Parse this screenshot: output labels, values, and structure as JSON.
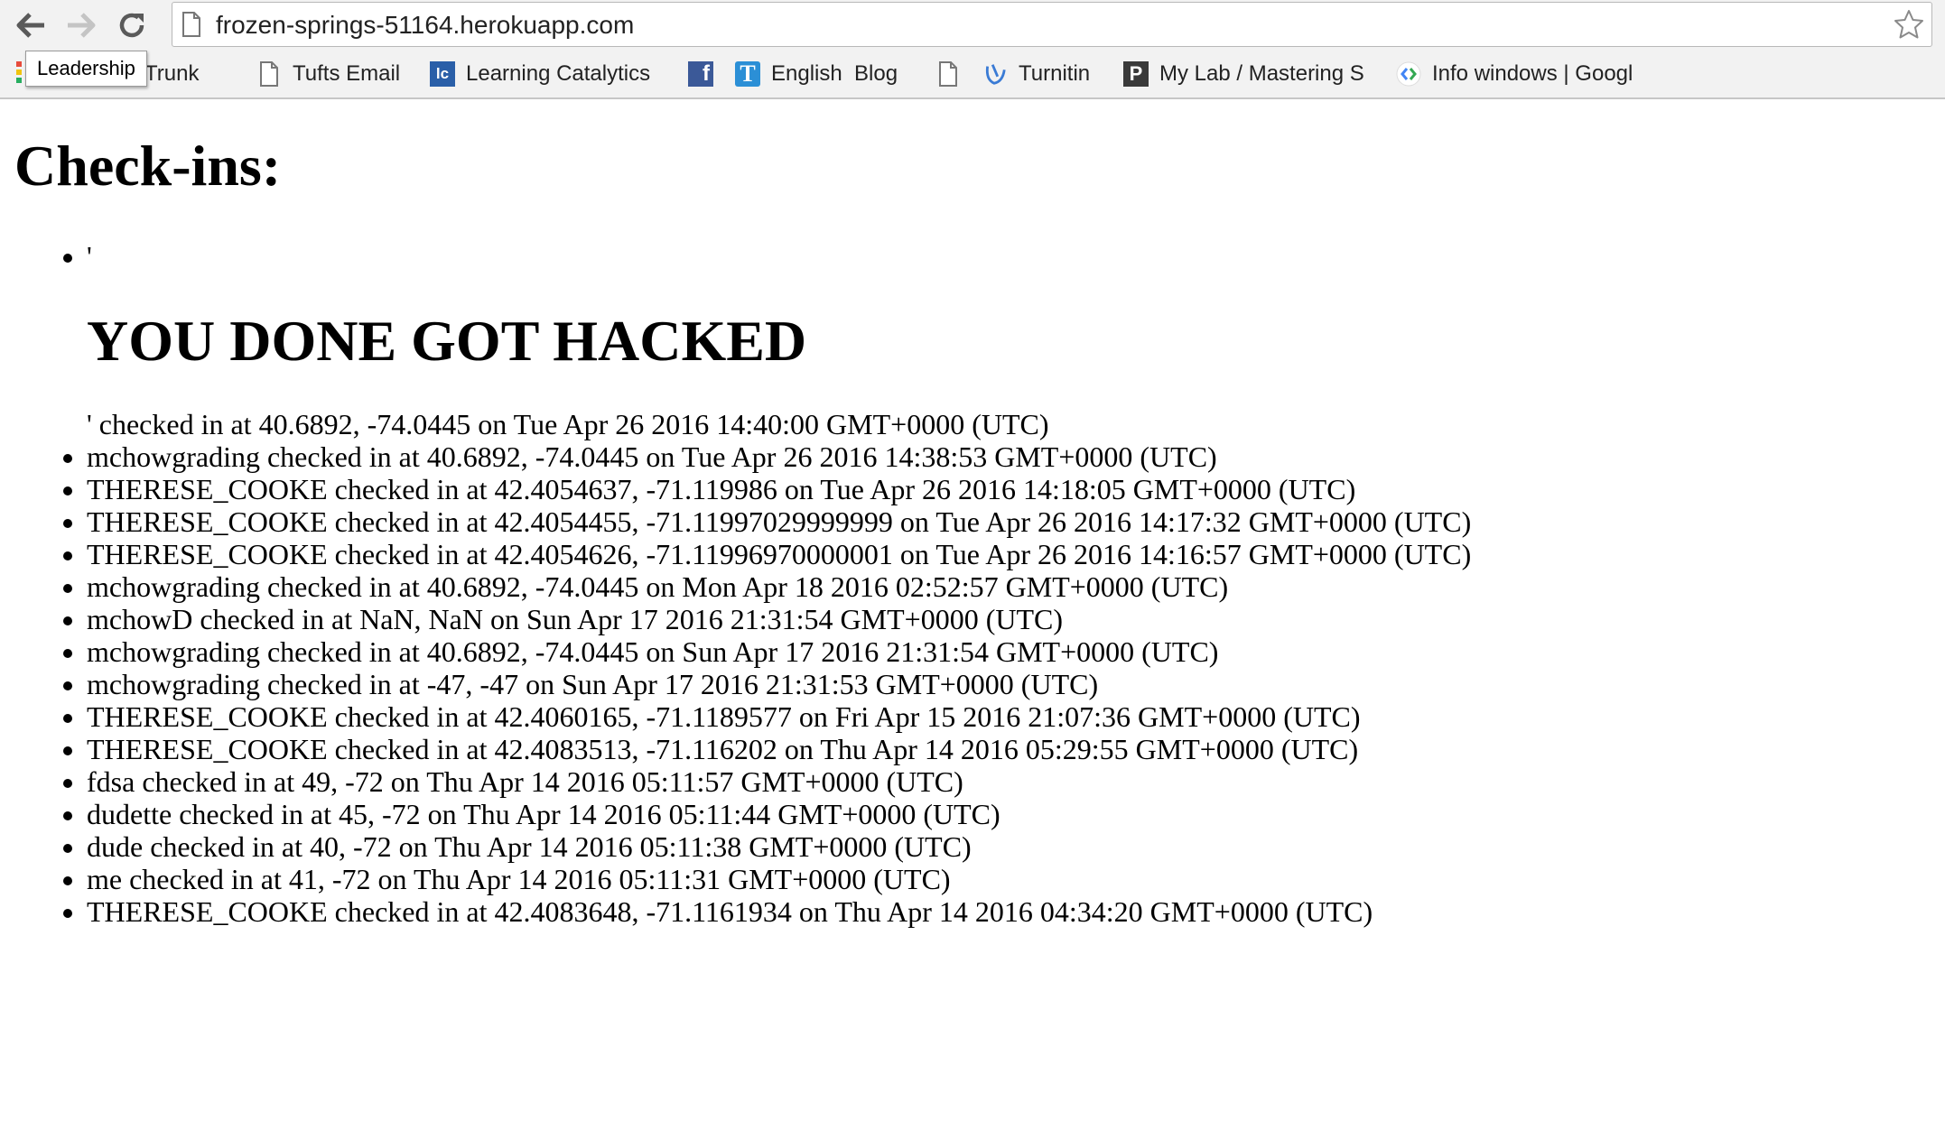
{
  "browser": {
    "url": "frozen-springs-51164.herokuapp.com",
    "tooltip": "Leadership",
    "bookmarks": [
      {
        "label": "Trunk",
        "icon": "trunk-icon"
      },
      {
        "label": "Tufts Email",
        "icon": "page-icon"
      },
      {
        "label": "Learning Catalytics",
        "icon": "learning-catalytics-icon"
      },
      {
        "label": "",
        "icon": "facebook-icon"
      },
      {
        "label": "English  Blog",
        "icon": "typepad-icon"
      },
      {
        "label": "",
        "icon": "page-icon"
      },
      {
        "label": "Turnitin",
        "icon": "turnitin-icon"
      },
      {
        "label": "My Lab / Mastering S",
        "icon": "pearson-icon"
      },
      {
        "label": "Info windows | Googl",
        "icon": "google-developers-icon"
      }
    ]
  },
  "page": {
    "title": "Check-ins:",
    "injected": {
      "prefix": "'",
      "heading": "YOU DONE GOT HACKED",
      "suffix": "' checked in at 40.6892, -74.0445 on Tue Apr 26 2016 14:40:00 GMT+0000 (UTC)"
    },
    "checkins": [
      "mchowgrading checked in at 40.6892, -74.0445 on Tue Apr 26 2016 14:38:53 GMT+0000 (UTC)",
      "THERESE_COOKE checked in at 42.4054637, -71.119986 on Tue Apr 26 2016 14:18:05 GMT+0000 (UTC)",
      "THERESE_COOKE checked in at 42.4054455, -71.11997029999999 on Tue Apr 26 2016 14:17:32 GMT+0000 (UTC)",
      "THERESE_COOKE checked in at 42.4054626, -71.11996970000001 on Tue Apr 26 2016 14:16:57 GMT+0000 (UTC)",
      "mchowgrading checked in at 40.6892, -74.0445 on Mon Apr 18 2016 02:52:57 GMT+0000 (UTC)",
      "mchowD checked in at NaN, NaN on Sun Apr 17 2016 21:31:54 GMT+0000 (UTC)",
      "mchowgrading checked in at 40.6892, -74.0445 on Sun Apr 17 2016 21:31:54 GMT+0000 (UTC)",
      "mchowgrading checked in at -47, -47 on Sun Apr 17 2016 21:31:53 GMT+0000 (UTC)",
      "THERESE_COOKE checked in at 42.4060165, -71.1189577 on Fri Apr 15 2016 21:07:36 GMT+0000 (UTC)",
      "THERESE_COOKE checked in at 42.4083513, -71.116202 on Thu Apr 14 2016 05:29:55 GMT+0000 (UTC)",
      "fdsa checked in at 49, -72 on Thu Apr 14 2016 05:11:57 GMT+0000 (UTC)",
      "dudette checked in at 45, -72 on Thu Apr 14 2016 05:11:44 GMT+0000 (UTC)",
      "dude checked in at 40, -72 on Thu Apr 14 2016 05:11:38 GMT+0000 (UTC)",
      "me checked in at 41, -72 on Thu Apr 14 2016 05:11:31 GMT+0000 (UTC)",
      "THERESE_COOKE checked in at 42.4083648, -71.1161934 on Thu Apr 14 2016 04:34:20 GMT+0000 (UTC)"
    ]
  }
}
